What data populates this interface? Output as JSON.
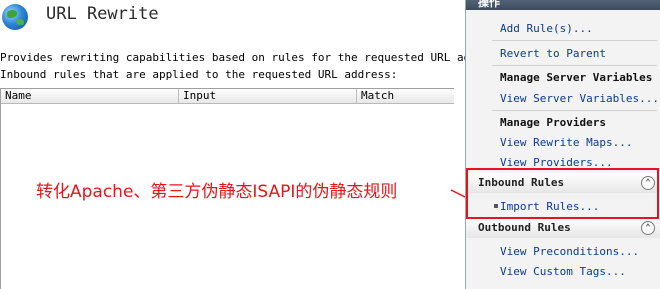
{
  "feature": {
    "title": "URL Rewrite",
    "description": "Provides rewriting capabilities based on rules for the requested URL address",
    "inbound_caption": "Inbound rules that are applied to the requested URL address:",
    "columns": [
      "Name",
      "Input",
      "Match"
    ]
  },
  "annotation": {
    "text": "转化Apache、第三方伪静态ISAPI的伪静态规则",
    "color": "#e8141a"
  },
  "actions": {
    "header": "操作",
    "add_rule": "Add Rule(s)...",
    "revert": "Revert to Parent",
    "manage_server_variables": "Manage Server Variables",
    "view_server_variables": "View Server Variables...",
    "manage_providers": "Manage Providers",
    "view_rewrite_maps": "View Rewrite Maps...",
    "view_providers": "View Providers...",
    "inbound_rules": "Inbound Rules",
    "import_rules": "Import Rules...",
    "outbound_rules": "Outbound Rules",
    "view_preconditions": "View Preconditions...",
    "view_custom_tags": "View Custom Tags..."
  },
  "icons": {
    "feature_icon": "globe-icon",
    "collapse": "collapse-up-icon"
  },
  "colors": {
    "link": "#0b3b8c",
    "highlight": "#e8141a"
  }
}
